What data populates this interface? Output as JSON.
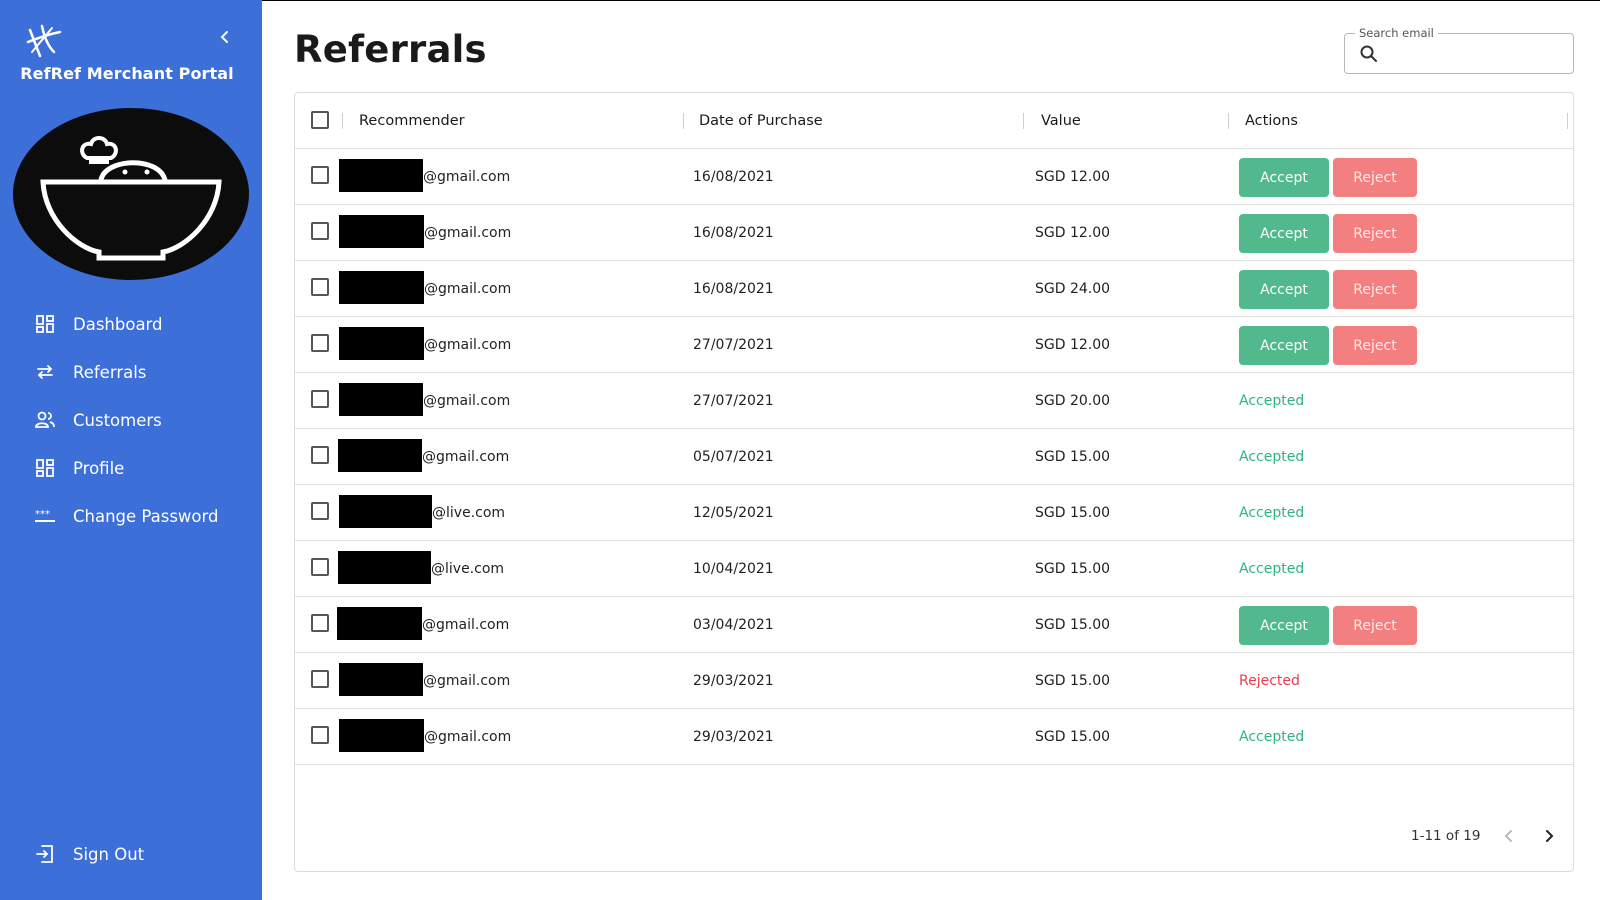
{
  "sidebar": {
    "brand_title": "RefRef Merchant Portal",
    "accent_color": "#3d6fd9",
    "nav": [
      {
        "label": "Dashboard",
        "icon": "dashboard-icon"
      },
      {
        "label": "Referrals",
        "icon": "swap-arrows-icon"
      },
      {
        "label": "Customers",
        "icon": "people-icon"
      },
      {
        "label": "Profile",
        "icon": "dashboard-icon"
      },
      {
        "label": "Change Password",
        "icon": "password-icon"
      }
    ],
    "signout_label": "Sign Out"
  },
  "page": {
    "title": "Referrals"
  },
  "search": {
    "label": "Search email",
    "value": ""
  },
  "table": {
    "headers": {
      "recommender": "Recommender",
      "date": "Date of Purchase",
      "value": "Value",
      "actions": "Actions"
    },
    "accept_label": "Accept",
    "reject_label": "Reject",
    "rows": [
      {
        "email_suffix": "@gmail.com",
        "date": "16/08/2021",
        "value": "SGD 12.00",
        "status": ""
      },
      {
        "email_suffix": "@gmail.com",
        "date": "16/08/2021",
        "value": "SGD 12.00",
        "status": ""
      },
      {
        "email_suffix": "@gmail.com",
        "date": "16/08/2021",
        "value": "SGD 24.00",
        "status": ""
      },
      {
        "email_suffix": "@gmail.com",
        "date": "27/07/2021",
        "value": "SGD 12.00",
        "status": ""
      },
      {
        "email_suffix": "@gmail.com",
        "date": "27/07/2021",
        "value": "SGD 20.00",
        "status": "Accepted"
      },
      {
        "email_suffix": "@gmail.com",
        "date": "05/07/2021",
        "value": "SGD 15.00",
        "status": "Accepted"
      },
      {
        "email_suffix": "@live.com",
        "date": "12/05/2021",
        "value": "SGD 15.00",
        "status": "Accepted"
      },
      {
        "email_suffix": "@live.com",
        "date": "10/04/2021",
        "value": "SGD 15.00",
        "status": "Accepted"
      },
      {
        "email_suffix": "@gmail.com",
        "date": "03/04/2021",
        "value": "SGD 15.00",
        "status": ""
      },
      {
        "email_suffix": "@gmail.com",
        "date": "29/03/2021",
        "value": "SGD 15.00",
        "status": "Rejected"
      },
      {
        "email_suffix": "@gmail.com",
        "date": "29/03/2021",
        "value": "SGD 15.00",
        "status": "Accepted"
      }
    ]
  },
  "pagination": {
    "text": "1-11 of 19"
  },
  "colors": {
    "accept": "#52b98c",
    "reject": "#f47f80",
    "accepted_text": "#2fb37e",
    "rejected_text": "#ea3d4b"
  }
}
